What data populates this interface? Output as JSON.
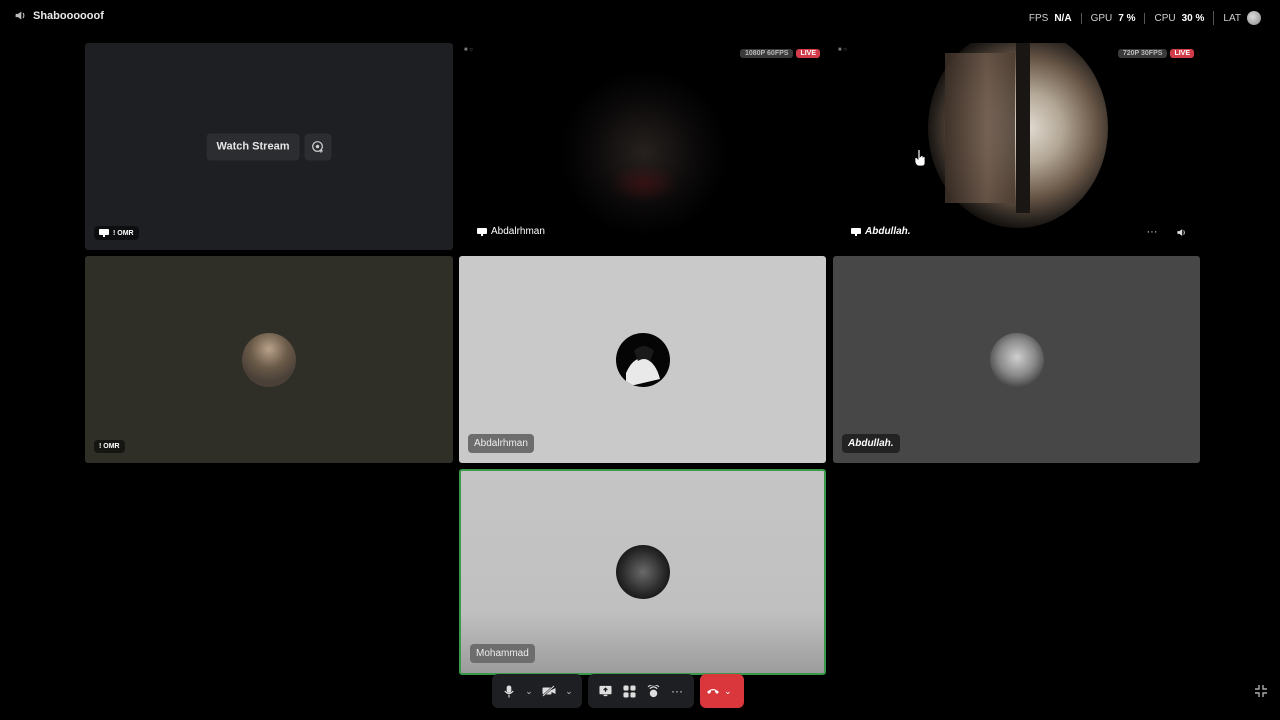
{
  "topbar": {
    "channel_name": "Shaboooooof",
    "fps_label": "FPS",
    "fps_value": "N/A",
    "gpu_label": "GPU",
    "gpu_value": "7 %",
    "cpu_label": "CPU",
    "cpu_value": "30 %",
    "lat_label": "LAT"
  },
  "tiles": {
    "stream_off": {
      "watch_label": "Watch Stream",
      "name": "! OMR"
    },
    "stream_a": {
      "quality": "1080P 60FPS",
      "live": "LIVE",
      "name": "Abdalrhman"
    },
    "stream_b": {
      "quality": "720P 30FPS",
      "live": "LIVE",
      "name": "Abdullah."
    },
    "omr": {
      "name": "! OMR"
    },
    "abdalrhman": {
      "name": "Abdalrhman"
    },
    "abdullah": {
      "name": "Abdullah."
    },
    "mohammad": {
      "name": "Mohammad"
    }
  }
}
